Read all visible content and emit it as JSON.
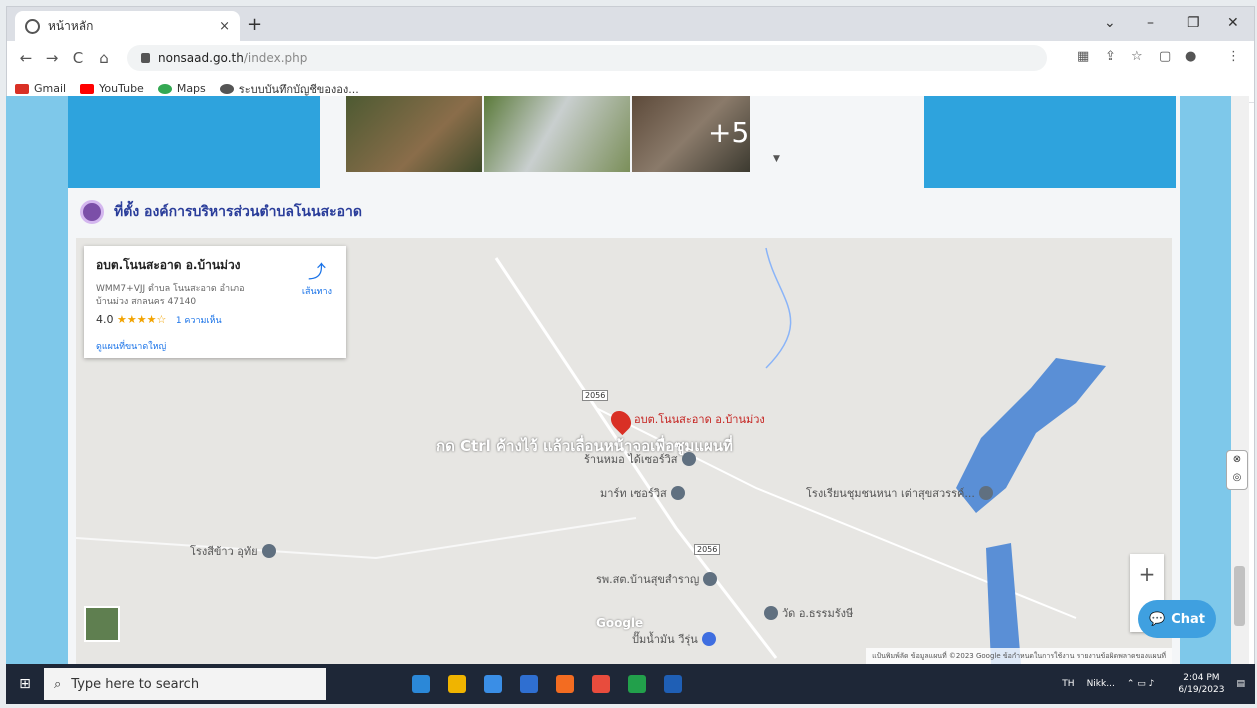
{
  "browser": {
    "tab_title": "หน้าหลัก",
    "tab_close": "×",
    "new_tab": "+",
    "window_controls": {
      "dropdown": "⌄",
      "minimize": "–",
      "maximize": "❐",
      "close": "✕"
    },
    "nav": {
      "back": "←",
      "forward": "→",
      "reload": "C",
      "home": "⌂"
    },
    "url_host": "nonsaad.go.th",
    "url_path": "/index.php",
    "bookmarks": [
      {
        "label": "Gmail",
        "color": "#d93025"
      },
      {
        "label": "YouTube",
        "color": "#ff0000"
      },
      {
        "label": "Maps",
        "color": "#34a853"
      },
      {
        "label": "ระบบบันทึกบัญชีขององ...",
        "color": "#555555"
      }
    ]
  },
  "page": {
    "photo_overlay": "+5",
    "section_title": "ที่ตั้ง องค์การบริหารส่วนตำบลโนนสะอาด",
    "map": {
      "place_name": "อบต.โนนสะอาด อ.บ้านม่วง",
      "address": "WMM7+VJJ ตำบล โนนสะอาด อำเภอ บ้านม่วง สกลนคร 47140",
      "rating": "4.0",
      "stars": "★★★★☆",
      "reviews": "1 ความเห็น",
      "view_larger": "ดูแผนที่ขนาดใหญ่",
      "directions": "เส้นทาง",
      "ctrl_message": "กด Ctrl ค้างไว้ แล้วเลื่อนหน้าจอเพื่อซูมแผนที่",
      "red_pin_label": "อบต.โนนสะอาด อ.บ้านม่วง",
      "pins": [
        {
          "label": "ร้านหมอ ได้เซอร์วิส"
        },
        {
          "label": "มาร์ท เซอร์วิส"
        },
        {
          "label": "โรงเรียนชุมชนหนา เต่าสุขสวรรค์..."
        },
        {
          "label": "โรงสีข้าว อุทัย"
        },
        {
          "label": "รพ.สต.บ้านสุขสำราญ"
        },
        {
          "label": "วัด อ.ธรรมรังษี"
        },
        {
          "label": "ปั๊มน้ำมัน วีรุ่น"
        }
      ],
      "road_number": "2056",
      "zoom_in": "+",
      "zoom_out": "−",
      "google_logo": "Google",
      "footer": "แป้นพิมพ์ลัด   ข้อมูลแผนที่ ©2023 Google   ข้อกำหนดในการใช้งาน   รายงานข้อผิดพลาดของแผนที่"
    },
    "chat_label": "Chat"
  },
  "taskbar": {
    "search_placeholder": "Type here to search",
    "apps": [
      "#2b88d8",
      "#f0b400",
      "#3a8ee6",
      "#2f6fd1",
      "#f36c21",
      "#e84c3d",
      "#22a04b",
      "#1f5fb5"
    ],
    "tray": {
      "lang": "TH",
      "user": "Nikk...",
      "time": "2:04 PM",
      "date": "6/19/2023"
    }
  }
}
